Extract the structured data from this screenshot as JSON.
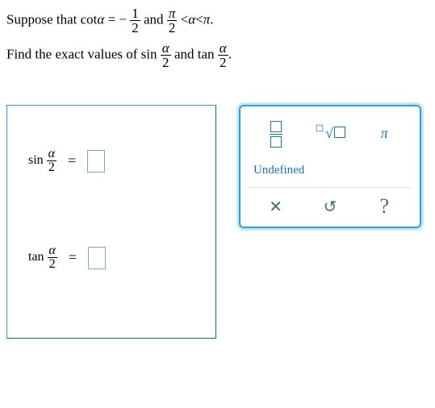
{
  "prompt": {
    "lead1": "Suppose that ",
    "cot": "cot",
    "alpha": "α",
    "minus": "−",
    "f1": {
      "num": "1",
      "den": "2"
    },
    "and1": " and ",
    "f2": {
      "num": "π",
      "den": "2"
    },
    "lt": "<",
    "dot": ".",
    "lead2": "Find the exact values of ",
    "sin": "sin",
    "tan": "tan",
    "fa": {
      "num": "α",
      "den": "2"
    },
    "and2": " and "
  },
  "answers": {
    "eq1": {
      "fn": "sin",
      "num": "α",
      "den": "2",
      "eq": "="
    },
    "eq2": {
      "fn": "tan",
      "num": "α",
      "den": "2",
      "eq": "="
    }
  },
  "palette": {
    "undefined": "Undefined",
    "pi": "π",
    "x": "✕",
    "reset": "↺",
    "help": "?"
  }
}
